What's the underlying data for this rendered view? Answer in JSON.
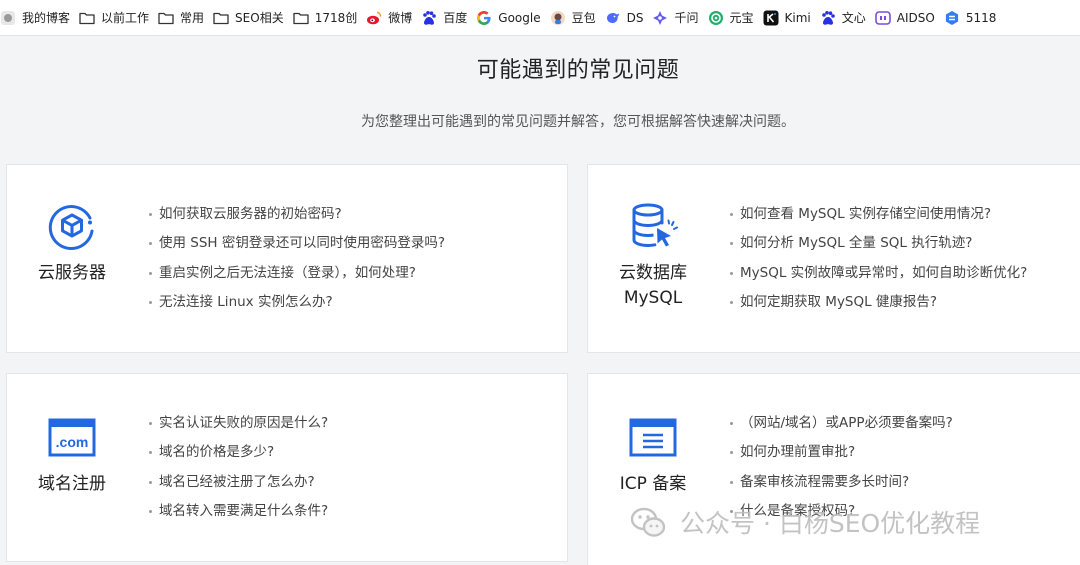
{
  "bookmarks": [
    {
      "label": "我的博客",
      "icon": "blog-icon"
    },
    {
      "label": "以前工作",
      "icon": "folder-icon"
    },
    {
      "label": "常用",
      "icon": "folder-icon"
    },
    {
      "label": "SEO相关",
      "icon": "folder-icon"
    },
    {
      "label": "1718创",
      "icon": "folder-icon"
    },
    {
      "label": "微博",
      "icon": "weibo-icon"
    },
    {
      "label": "百度",
      "icon": "baidu-icon"
    },
    {
      "label": "Google",
      "icon": "google-icon"
    },
    {
      "label": "豆包",
      "icon": "doubao-icon"
    },
    {
      "label": "DS",
      "icon": "deepseek-icon"
    },
    {
      "label": "千问",
      "icon": "qianwen-icon"
    },
    {
      "label": "元宝",
      "icon": "yuanbao-icon"
    },
    {
      "label": "Kimi",
      "icon": "kimi-icon"
    },
    {
      "label": "文心",
      "icon": "baidu-icon"
    },
    {
      "label": "AIDSO",
      "icon": "aidso-icon"
    },
    {
      "label": "5118",
      "icon": "5118-icon"
    }
  ],
  "page": {
    "title": "可能遇到的常见问题",
    "subtitle": "为您整理出可能遇到的常见问题并解答，您可根据解答快速解决问题。"
  },
  "cards": [
    {
      "name_line1": "云服务器",
      "name_line2": "",
      "icon": "cloud-server-icon",
      "questions": [
        "如何获取云服务器的初始密码?",
        "使用 SSH 密钥登录还可以同时使用密码登录吗?",
        "重启实例之后无法连接（登录），如何处理?",
        "无法连接 Linux 实例怎么办?"
      ]
    },
    {
      "name_line1": "云数据库",
      "name_line2": "MySQL",
      "icon": "database-icon",
      "questions": [
        "如何查看 MySQL 实例存储空间使用情况?",
        "如何分析 MySQL 全量 SQL 执行轨迹?",
        "MySQL 实例故障或异常时，如何自助诊断优化?",
        "如何定期获取 MySQL 健康报告?"
      ]
    },
    {
      "name_line1": "域名注册",
      "name_line2": "",
      "icon": "domain-com-icon",
      "questions": [
        "实名认证失败的原因是什么?",
        "域名的价格是多少?",
        "域名已经被注册了怎么办?",
        "域名转入需要满足什么条件?"
      ]
    },
    {
      "name_line1": "ICP 备案",
      "name_line2": "",
      "icon": "icp-filing-icon",
      "questions": [
        "（网站/域名）或APP必须要备案吗?",
        "如何办理前置审批?",
        "备案审核流程需要多长时间?",
        "什么是备案授权码?"
      ]
    }
  ],
  "watermark": {
    "text": "公众号 · 白杨SEO优化教程",
    "icon": "wechat-icon"
  },
  "colors": {
    "accent": "#2468e0",
    "background": "#f3f4f6",
    "card": "#ffffff"
  }
}
